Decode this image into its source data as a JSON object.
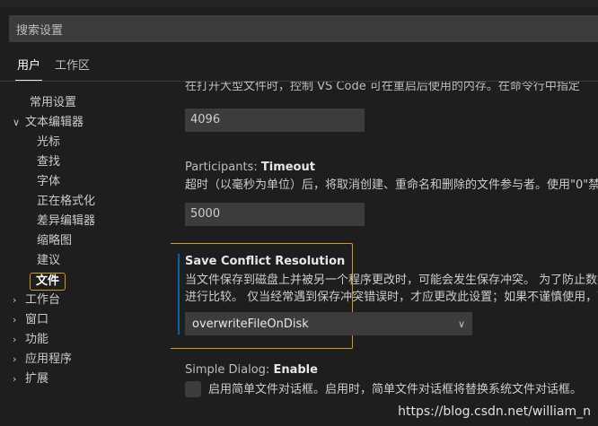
{
  "search": {
    "placeholder": "搜索设置"
  },
  "tabs": [
    {
      "label": "用户"
    },
    {
      "label": "工作区"
    }
  ],
  "toc": {
    "common": "常用设置",
    "text_editor": "文本编辑器",
    "text_editor_children": [
      "光标",
      "查找",
      "字体",
      "正在格式化",
      "差异编辑器",
      "缩略图",
      "建议",
      "文件"
    ],
    "others": [
      "工作台",
      "窗口",
      "功能",
      "应用程序",
      "扩展"
    ]
  },
  "settings": {
    "cutoff_text": "在打开大型文件时，控制 VS Code 可在重启后使用的内存。在命令行中指定",
    "memory_value": "4096",
    "participants": {
      "prefix": "Participants: ",
      "name": "Timeout",
      "description": "超时（以毫秒为单位）后，将取消创建、重命名和删除的文件参与者。使用\"0\"禁",
      "value": "5000"
    },
    "save_conflict": {
      "title": "Save Conflict Resolution",
      "description_line1": "当文件保存到磁盘上并被另一个程序更改时，可能会发生保存冲突。 为了防止数据",
      "description_line2": "进行比较。 仅当经常遇到保存冲突错误时，才应更改此设置；如果不谨慎使用，可",
      "selected": "overwriteFileOnDisk"
    },
    "simple_dialog": {
      "prefix": "Simple Dialog: ",
      "name": "Enable",
      "label": "启用简单文件对话框。启用时，简单文件对话框将替换系统文件对话框。"
    }
  },
  "watermark": "https://blog.csdn.net/william_n",
  "colors": {
    "focus_border": "#d29922",
    "modified_indicator": "#0e639c",
    "background": "#1e1e1e"
  }
}
